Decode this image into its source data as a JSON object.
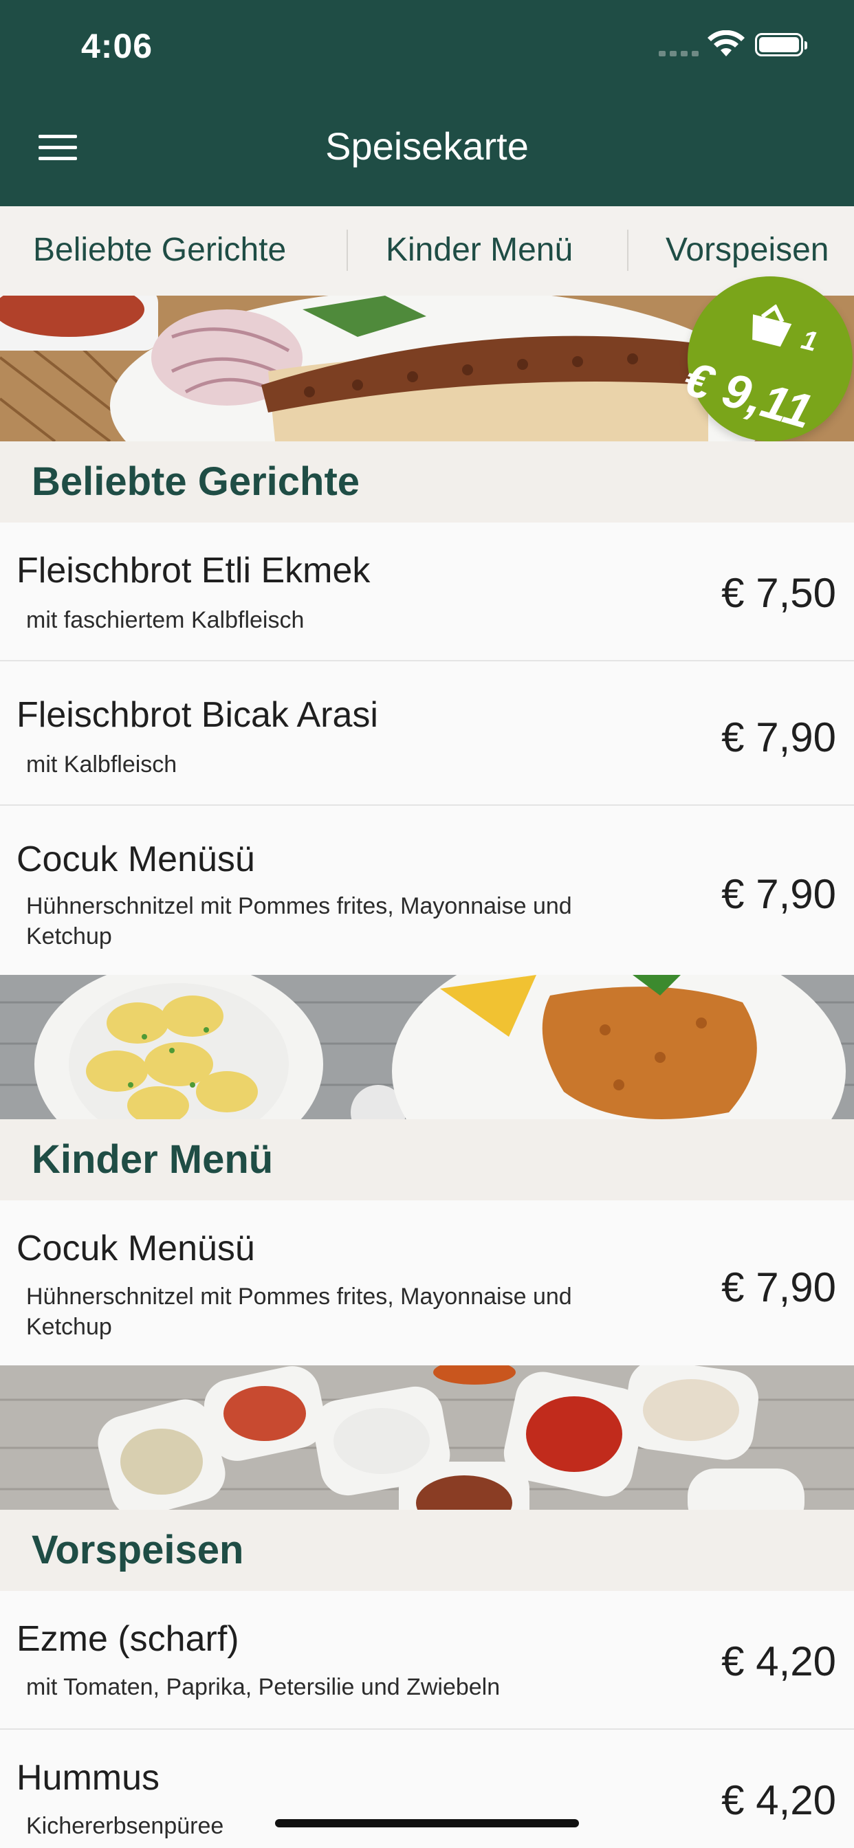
{
  "status_bar": {
    "time": "4:06"
  },
  "header": {
    "title": "Speisekarte",
    "menu_icon": "hamburger-menu-icon"
  },
  "tabs": [
    {
      "label": "Beliebte Gerichte"
    },
    {
      "label": "Kinder Menü"
    },
    {
      "label": "Vorspeisen"
    }
  ],
  "cart": {
    "count": "1",
    "total": "€ 9,11",
    "icon": "shopping-basket-icon",
    "color": "#7aa51a"
  },
  "sections": [
    {
      "title": "Beliebte Gerichte",
      "items": [
        {
          "name": "Fleischbrot Etli Ekmek",
          "desc": "mit faschiertem Kalbfleisch",
          "price": "€ 7,50"
        },
        {
          "name": "Fleischbrot  Bicak Arasi",
          "desc": "mit Kalbfleisch",
          "price": "€ 7,90"
        },
        {
          "name": "Cocuk Menüsü",
          "desc": "Hühnerschnitzel mit Pommes frites, Mayonnaise und Ketchup",
          "price": "€ 7,90"
        }
      ]
    },
    {
      "title": "Kinder Menü",
      "items": [
        {
          "name": "Cocuk Menüsü",
          "desc": "Hühnerschnitzel mit Pommes frites, Mayonnaise und Ketchup",
          "price": "€ 7,90"
        }
      ]
    },
    {
      "title": "Vorspeisen",
      "items": [
        {
          "name": "Ezme (scharf)",
          "desc": "mit Tomaten, Paprika, Petersilie und Zwiebeln",
          "price": "€ 4,20"
        },
        {
          "name": "Hummus",
          "desc": "Kichererbsenpüree",
          "price": "€ 4,20"
        }
      ]
    }
  ],
  "colors": {
    "primary": "#1f4d45",
    "section_bg": "#f2efeb",
    "accent": "#7aa51a"
  }
}
